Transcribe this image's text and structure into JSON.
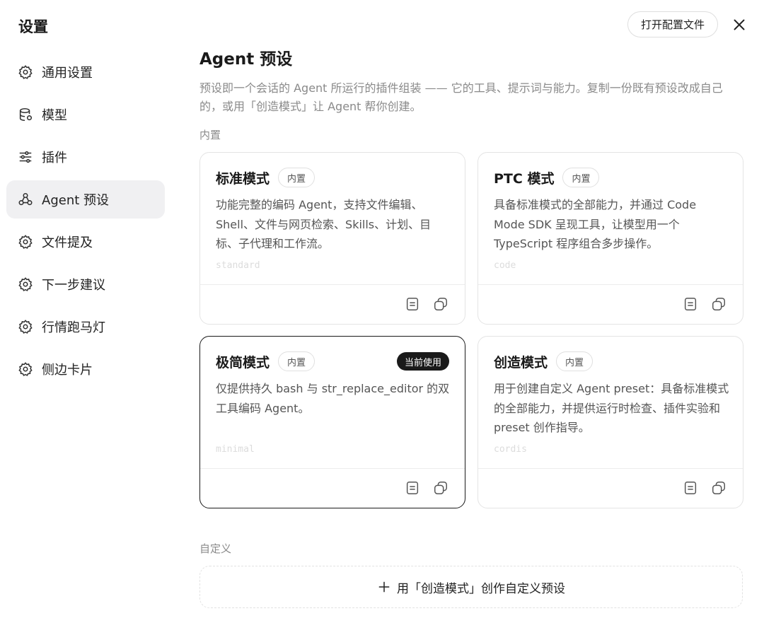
{
  "sidebar": {
    "title": "设置",
    "items": [
      {
        "label": "通用设置",
        "icon": "gear-icon"
      },
      {
        "label": "模型",
        "icon": "database-icon"
      },
      {
        "label": "插件",
        "icon": "sliders-icon"
      },
      {
        "label": "Agent 预设",
        "icon": "agent-icon",
        "active": true
      },
      {
        "label": "文件提及",
        "icon": "gear-icon"
      },
      {
        "label": "下一步建议",
        "icon": "gear-icon"
      },
      {
        "label": "行情跑马灯",
        "icon": "gear-icon"
      },
      {
        "label": "侧边卡片",
        "icon": "gear-icon"
      }
    ]
  },
  "header": {
    "open_config_label": "打开配置文件",
    "close_icon": "close-icon"
  },
  "main": {
    "title": "Agent 预设",
    "description": "预设即一个会话的 Agent 所运行的插件组装 —— 它的工具、提示词与能力。复制一份既有预设改成自己的，或用「创造模式」让 Agent 帮你创建。",
    "builtin_label": "内置",
    "custom_label": "自定义",
    "create_button_label": "用「创造模式」创作自定义预设",
    "cards": [
      {
        "name": "标准模式",
        "badge": "内置",
        "description": "功能完整的编码 Agent，支持文件编辑、Shell、文件与网页检索、Skills、计划、目标、子代理和工作流。",
        "id": "standard",
        "current": false
      },
      {
        "name": "PTC 模式",
        "badge": "内置",
        "description": "具备标准模式的全部能力，并通过 Code Mode SDK 呈现工具，让模型用一个 TypeScript 程序组合多步操作。",
        "id": "code",
        "current": false
      },
      {
        "name": "极简模式",
        "badge": "内置",
        "current_badge": "当前使用",
        "description": "仅提供持久 bash 与 str_replace_editor 的双工具编码 Agent。",
        "id": "minimal",
        "current": true
      },
      {
        "name": "创造模式",
        "badge": "内置",
        "description": "用于创建自定义 Agent preset：具备标准模式的全部能力，并提供运行时检查、插件实验和 preset 创作指导。",
        "id": "cordis",
        "current": false
      }
    ]
  }
}
